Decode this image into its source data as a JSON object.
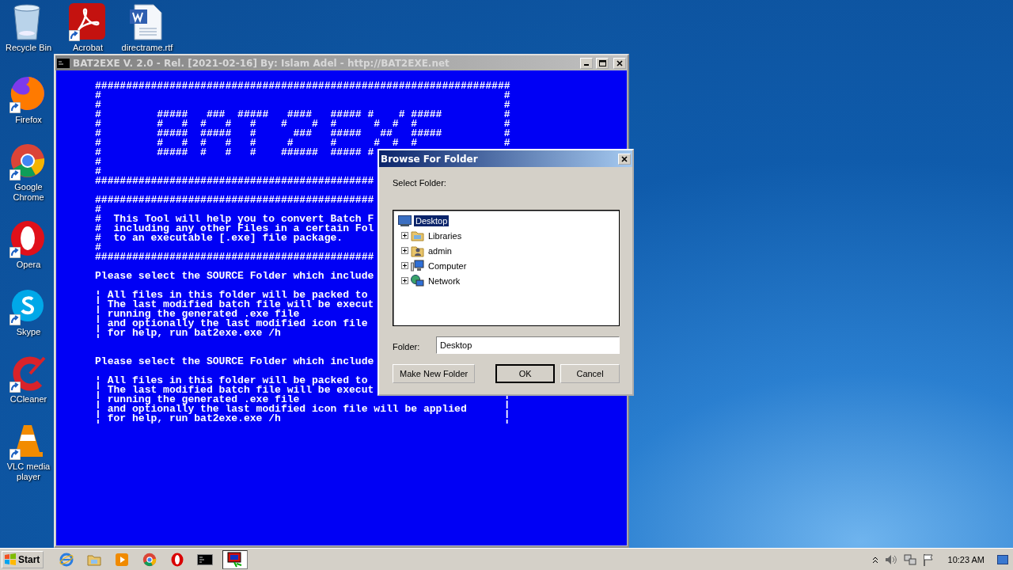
{
  "desktop_icons_top": [
    {
      "label": "Recycle Bin",
      "kind": "recycle",
      "shortcut": false
    },
    {
      "label": "Acrobat",
      "kind": "acrobat",
      "shortcut": true
    },
    {
      "label": "directrame.rtf",
      "kind": "word",
      "shortcut": false
    }
  ],
  "desktop_icons": [
    {
      "label": "Firefox",
      "kind": "firefox",
      "shortcut": true
    },
    {
      "label": "Google Chrome",
      "kind": "chrome",
      "shortcut": true
    },
    {
      "label": "Opera",
      "kind": "opera",
      "shortcut": true
    },
    {
      "label": "Skype",
      "kind": "skype",
      "shortcut": true
    },
    {
      "label": "CCleaner",
      "kind": "ccleaner",
      "shortcut": true
    },
    {
      "label": "VLC media player",
      "kind": "vlc",
      "shortcut": true
    }
  ],
  "console": {
    "title": "BAT2EXE V. 2.0 - Rel. [2021-02-16] By: Islam Adel - http://BAT2EXE.net",
    "lines": [
      {
        "kind": "line",
        "text": "###################################################################"
      },
      {
        "kind": "line",
        "text": "#",
        "edge": "#"
      },
      {
        "kind": "line",
        "text": "#",
        "edge": "#"
      },
      {
        "kind": "line",
        "text": "#         #####   ###  #####   ####   ##### #    # #####",
        "edge": "#"
      },
      {
        "kind": "line",
        "text": "#         #   #  #   #   #    #    #  #      #  #  #",
        "edge": "#"
      },
      {
        "kind": "line",
        "text": "#         #####  #####   #      ###   #####   ##   #####",
        "edge": "#"
      },
      {
        "kind": "line",
        "text": "#         #   #  #   #   #     #      #      #  #  #",
        "edge": "#"
      },
      {
        "kind": "line",
        "text": "#         #####  #   #   #    ######  ##### #"
      },
      {
        "kind": "line",
        "text": "#"
      },
      {
        "kind": "line",
        "text": "#"
      },
      {
        "kind": "line",
        "text": "#############################################"
      },
      {
        "kind": "blank"
      },
      {
        "kind": "line",
        "text": "#############################################"
      },
      {
        "kind": "line",
        "text": "#"
      },
      {
        "kind": "line",
        "text": "#  This Tool will help you to convert Batch F"
      },
      {
        "kind": "line",
        "text": "#  including any other Files in a certain Fol"
      },
      {
        "kind": "line",
        "text": "#  to an executable [.exe] file package."
      },
      {
        "kind": "line",
        "text": "#"
      },
      {
        "kind": "line",
        "text": "#############################################"
      },
      {
        "kind": "blank"
      },
      {
        "kind": "line",
        "text": "Please select the SOURCE Folder which include"
      },
      {
        "kind": "blank"
      },
      {
        "kind": "line",
        "text": "¦ All files in this folder will be packed to"
      },
      {
        "kind": "line",
        "text": "¦ The last modified batch file will be execut"
      },
      {
        "kind": "line",
        "text": "¦ running the generated .exe file"
      },
      {
        "kind": "line",
        "text": "¦ and optionally the last modified icon file"
      },
      {
        "kind": "line",
        "text": "¦ for help, run bat2exe.exe /h"
      },
      {
        "kind": "blank"
      },
      {
        "kind": "blank"
      },
      {
        "kind": "line",
        "text": "Please select the SOURCE Folder which include"
      },
      {
        "kind": "blank"
      },
      {
        "kind": "line",
        "text": "¦ All files in this folder will be packed to"
      },
      {
        "kind": "line",
        "text": "¦ The last modified batch file will be execut"
      },
      {
        "kind": "line",
        "text": "¦ running the generated .exe file",
        "edge": "¦"
      },
      {
        "kind": "line",
        "text": "¦ and optionally the last modified icon file will be applied",
        "edge": "¦"
      },
      {
        "kind": "line",
        "text": "¦ for help, run bat2exe.exe /h",
        "edge": "¦"
      }
    ]
  },
  "dialog": {
    "title": "Browse For Folder",
    "prompt": "Select Folder:",
    "tree": [
      {
        "label": "Desktop",
        "kind": "desktop",
        "selected": true,
        "children": [
          {
            "label": "Libraries",
            "kind": "libraries",
            "selected": false,
            "expanded": false
          },
          {
            "label": "admin",
            "kind": "user",
            "selected": false,
            "expanded": false
          },
          {
            "label": "Computer",
            "kind": "computer",
            "selected": false,
            "expanded": false
          },
          {
            "label": "Network",
            "kind": "network",
            "selected": false,
            "expanded": false
          }
        ]
      }
    ],
    "folder_label": "Folder:",
    "folder_value": "Desktop",
    "buttons": [
      {
        "label": "Make New Folder",
        "default": false
      },
      {
        "label": "OK",
        "default": true
      },
      {
        "label": "Cancel",
        "default": false
      }
    ]
  },
  "taskbar": {
    "start": "Start",
    "apps": [
      {
        "kind": "ie",
        "active": false
      },
      {
        "kind": "explorer",
        "active": false
      },
      {
        "kind": "media",
        "active": false
      },
      {
        "kind": "chrome",
        "active": false
      },
      {
        "kind": "opera",
        "active": false
      },
      {
        "kind": "cmd",
        "active": false
      },
      {
        "kind": "bat2exe",
        "active": true
      }
    ],
    "clock": "10:23 AM"
  }
}
